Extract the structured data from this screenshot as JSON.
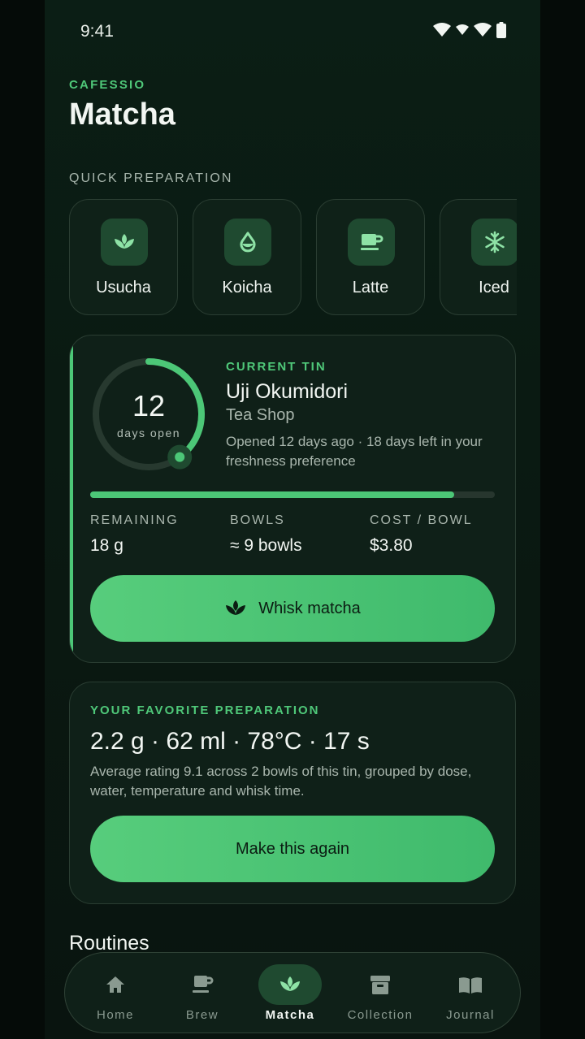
{
  "status": {
    "time": "9:41"
  },
  "app": {
    "brand": "CAFESSIO",
    "title": "Matcha"
  },
  "quick": {
    "label": "QUICK PREPARATION",
    "items": [
      {
        "label": "Usucha",
        "icon": "leaf-icon"
      },
      {
        "label": "Koicha",
        "icon": "drop-icon"
      },
      {
        "label": "Latte",
        "icon": "cup-icon"
      },
      {
        "label": "Iced",
        "icon": "snowflake-icon"
      }
    ]
  },
  "tin": {
    "days_open": "12",
    "days_open_label": "days open",
    "freshness_fraction": 0.4,
    "label": "CURRENT TIN",
    "name": "Uji Okumidori",
    "shop": "Tea Shop",
    "note": "Opened 12 days ago · 18 days left in your freshness preference",
    "remaining_fraction": 0.9,
    "stats": [
      {
        "label": "REMAINING",
        "value": "18 g"
      },
      {
        "label": "BOWLS",
        "value": "≈ 9 bowls"
      },
      {
        "label": "COST / BOWL",
        "value": "$3.80"
      }
    ],
    "cta": "Whisk matcha"
  },
  "favorite": {
    "label": "YOUR FAVORITE PREPARATION",
    "recipe": "2.2 g · 62 ml · 78°C · 17 s",
    "description": "Average rating 9.1 across 2 bowls of this tin, grouped by dose, water, temperature and whisk time.",
    "cta": "Make this again"
  },
  "routines": {
    "title": "Routines"
  },
  "nav": {
    "items": [
      {
        "label": "Home",
        "icon": "home-icon"
      },
      {
        "label": "Brew",
        "icon": "brew-icon"
      },
      {
        "label": "Matcha",
        "icon": "leaf-icon",
        "active": true
      },
      {
        "label": "Collection",
        "icon": "archive-icon"
      },
      {
        "label": "Journal",
        "icon": "book-icon"
      }
    ]
  },
  "colors": {
    "accent": "#4cc777",
    "surface": "#0f2018",
    "background": "#050b08"
  }
}
